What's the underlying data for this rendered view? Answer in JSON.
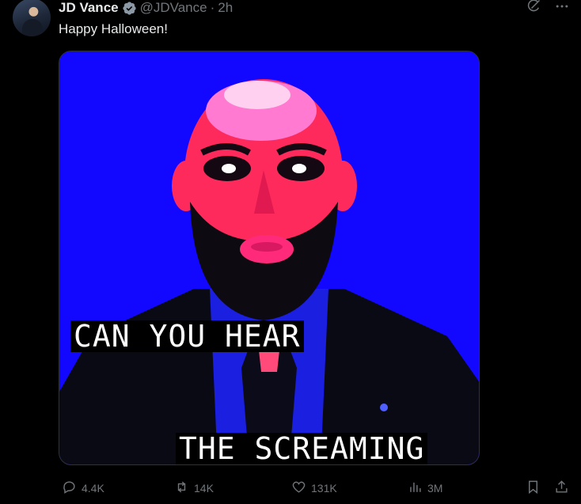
{
  "author": {
    "display_name": "JD Vance",
    "handle": "@JDVance",
    "separator": "·",
    "time": "2h"
  },
  "tweet": {
    "text": "Happy Halloween!"
  },
  "media": {
    "caption_line1": "CAN YOU HEAR",
    "caption_line2": "THE SCREAMING"
  },
  "actions": {
    "replies": "4.4K",
    "reposts": "14K",
    "likes": "131K",
    "views": "3M"
  },
  "icons": {
    "verified": "verified-badge-icon",
    "grok": "grok-icon",
    "more": "more-icon",
    "reply": "reply-icon",
    "repost": "repost-icon",
    "like": "heart-icon",
    "views": "views-icon",
    "bookmark": "bookmark-icon",
    "share": "share-icon"
  },
  "colors": {
    "background": "#000000",
    "text": "#e7e9ea",
    "muted": "#71767b",
    "media_bg": "#1208ff",
    "face": "#ff2a5c"
  }
}
